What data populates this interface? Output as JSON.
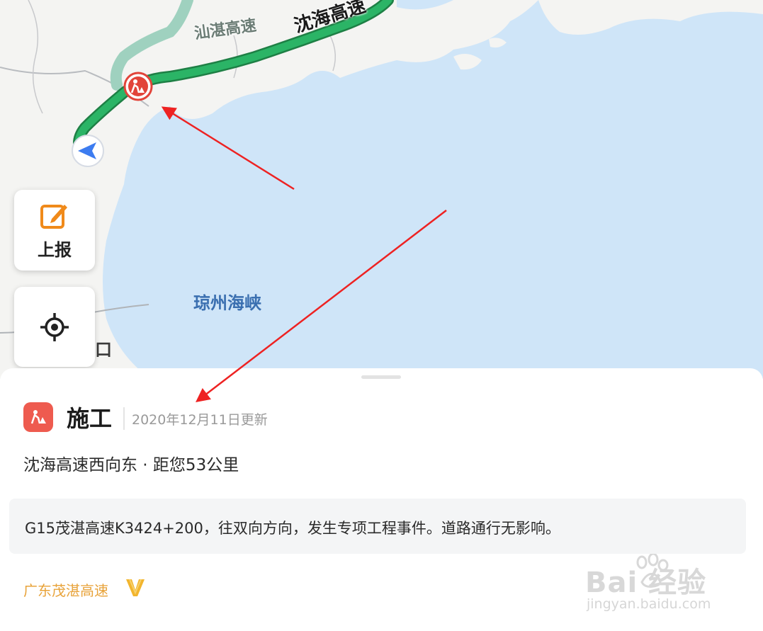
{
  "map": {
    "road_primary_label": "沈海高速",
    "road_secondary_label": "汕湛高速",
    "water_label": "琼州海峡",
    "partial_label": "口",
    "report_button_label": "上报",
    "colors": {
      "water": "#cfe5f8",
      "land": "#f4f4f2",
      "route": "#23a35a",
      "secondary_road": "#9fd1bf",
      "construction": "#e2443a",
      "nav": "#3d7cf0",
      "annotation_arrow": "#ee2222"
    },
    "icons": {
      "report": "edit-report-icon",
      "locate": "locate-icon",
      "construction_marker": "construction-worker-icon",
      "navigation": "navigation-arrow-icon"
    }
  },
  "panel": {
    "title": "施工",
    "update_time": "2020年12月11日更新",
    "route_info": "沈海高速西向东 · 距您53公里",
    "description": "G15茂湛高速K3424+200，往双向方向，发生专项工程事件。道路通行无影响。",
    "source": "广东茂湛高速",
    "icons": {
      "event": "construction-worker-icon",
      "verified": "verified-v-icon"
    }
  },
  "watermark": {
    "logo_text": "Bai  经验",
    "url": "jingyan.baidu.com"
  }
}
